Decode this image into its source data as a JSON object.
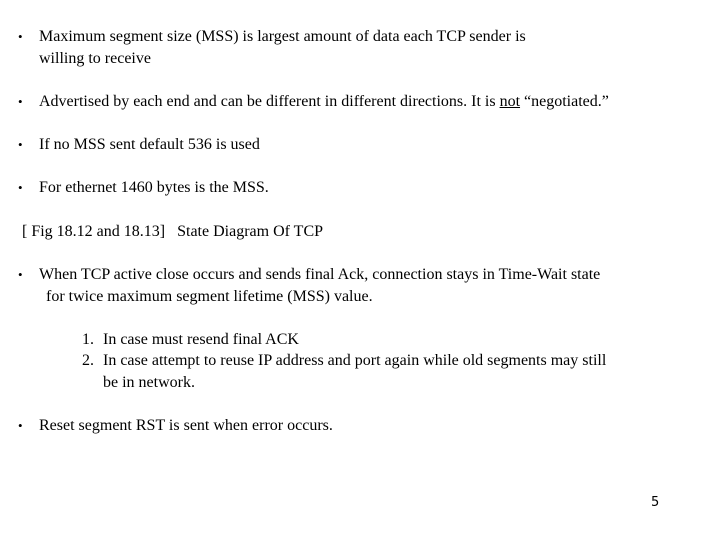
{
  "bullets": [
    {
      "line1": "Maximum segment size (MSS) is largest amount of data each TCP sender is",
      "line2": "willing to  receive"
    },
    {
      "before": "Advertised by each end and can be different in different directions. It is ",
      "emphasis": "not",
      "after": " “negotiated.”"
    },
    {
      "text": "If no MSS sent default 536 is used"
    },
    {
      "text": "For ethernet 1460 bytes is the MSS."
    }
  ],
  "figure_reference": "[ Fig 18.12 and 18.13]   State Diagram Of TCP",
  "time_wait": {
    "line1": "When TCP active close occurs and sends final Ack, connection stays in Time-Wait state",
    "line2": "for twice maximum segment lifetime (MSS) value."
  },
  "reasons": [
    {
      "number": "1.",
      "text": "In case must resend final ACK"
    },
    {
      "number": "2.",
      "line1": "In case attempt to reuse IP address and port again while old segments may still",
      "line2": "be in network."
    }
  ],
  "reset": {
    "text": "Reset segment RST is sent when error occurs."
  },
  "bullet_glyph": "•",
  "page_number": "5"
}
